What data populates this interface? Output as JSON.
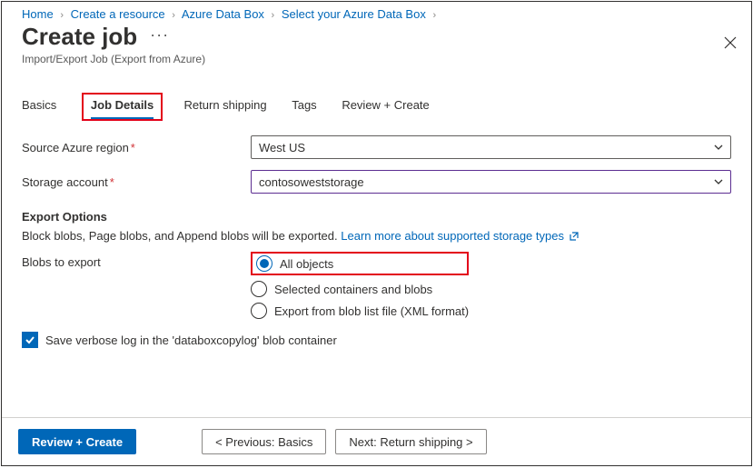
{
  "breadcrumbs": {
    "items": [
      {
        "label": "Home"
      },
      {
        "label": "Create a resource"
      },
      {
        "label": "Azure Data Box"
      },
      {
        "label": "Select your Azure Data Box"
      }
    ]
  },
  "header": {
    "title": "Create job",
    "subtitle": "Import/Export Job (Export from Azure)"
  },
  "tabs": {
    "items": [
      {
        "label": "Basics",
        "active": false
      },
      {
        "label": "Job Details",
        "active": true
      },
      {
        "label": "Return shipping",
        "active": false
      },
      {
        "label": "Tags",
        "active": false
      },
      {
        "label": "Review + Create",
        "active": false
      }
    ]
  },
  "fields": {
    "source_region": {
      "label": "Source Azure region",
      "value": "West US"
    },
    "storage_account": {
      "label": "Storage account",
      "value": "contosoweststorage"
    }
  },
  "export": {
    "section_title": "Export Options",
    "helper_text": "Block blobs, Page blobs, and Append blobs will be exported. ",
    "learn_more": "Learn more about supported storage types",
    "blobs_label": "Blobs to export",
    "options": [
      {
        "label": "All objects",
        "selected": true
      },
      {
        "label": "Selected containers and blobs",
        "selected": false
      },
      {
        "label": "Export from blob list file (XML format)",
        "selected": false
      }
    ],
    "verbose_log": {
      "label": "Save verbose log in the 'databoxcopylog' blob container",
      "checked": true
    }
  },
  "footer": {
    "review": "Review + Create",
    "previous": "< Previous: Basics",
    "next": "Next: Return shipping >"
  }
}
